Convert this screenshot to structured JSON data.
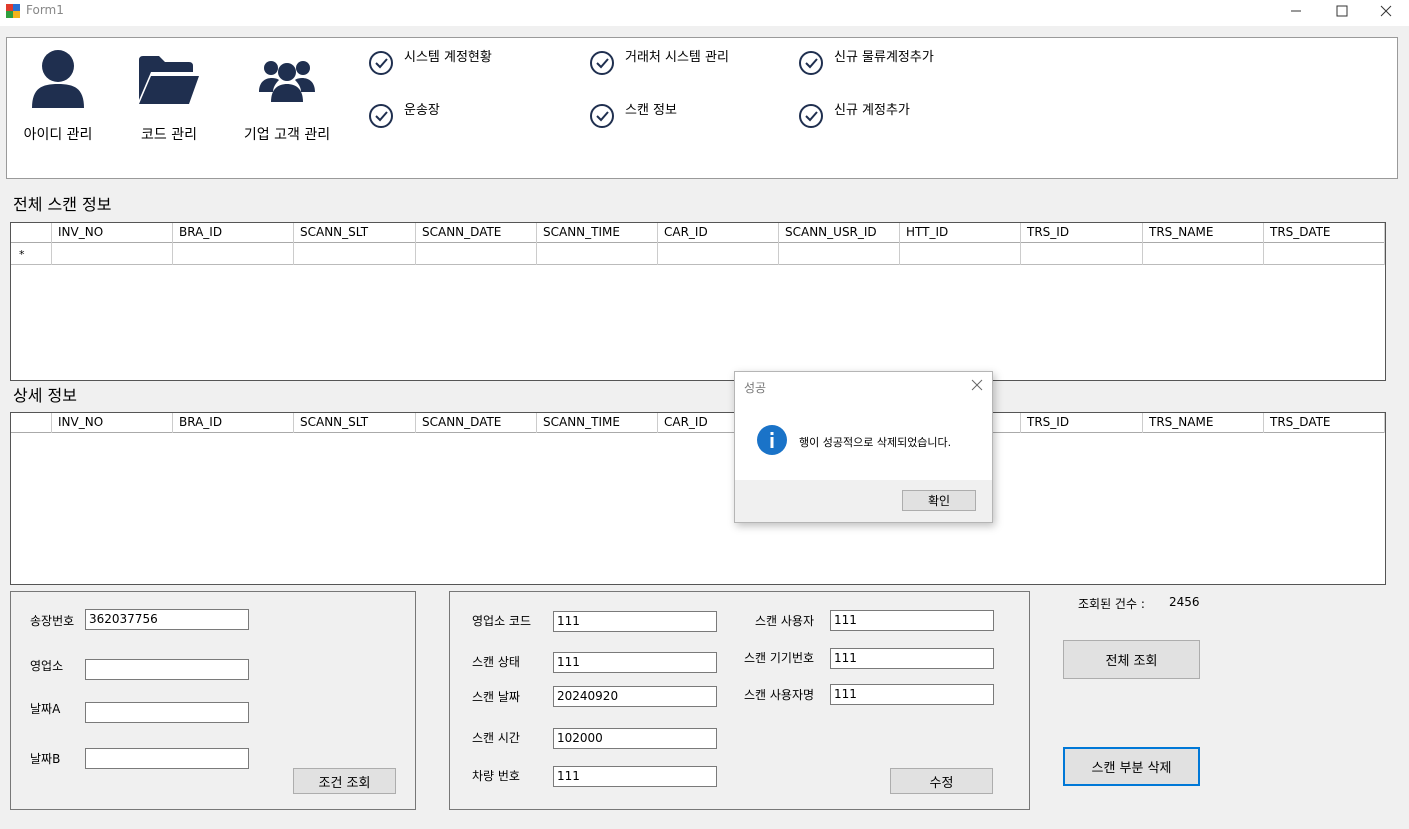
{
  "window": {
    "title": "Form1",
    "minimize_glyph": "—",
    "maximize_glyph": "☐",
    "close_glyph": "✕"
  },
  "menu": {
    "big_items": [
      {
        "label": "아이디 관리",
        "icon": "user-icon"
      },
      {
        "label": "코드 관리",
        "icon": "folder-icon"
      },
      {
        "label": "기업 고객 관리",
        "icon": "users-icon"
      }
    ],
    "check_items": [
      {
        "label": "시스템 계정현황"
      },
      {
        "label": "거래처 시스템 관리"
      },
      {
        "label": "신규 물류계정추가"
      },
      {
        "label": "운송장"
      },
      {
        "label": "스캔 정보"
      },
      {
        "label": "신규 계정추가"
      }
    ]
  },
  "sections": {
    "all_scan": "전체 스캔 정보",
    "detail": "상세 정보"
  },
  "grid": {
    "columns": [
      "INV_NO",
      "BRA_ID",
      "SCANN_SLT",
      "SCANN_DATE",
      "SCANN_TIME",
      "CAR_ID",
      "SCANN_USR_ID",
      "HTT_ID",
      "TRS_ID",
      "TRS_NAME",
      "TRS_DATE"
    ],
    "new_row_marker": "*"
  },
  "search_box": {
    "invoice_label": "송장번호",
    "invoice_value": "362037756",
    "branch_label": "영업소",
    "branch_value": "",
    "date_a_label": "날짜A",
    "date_a_value": "",
    "date_b_label": "날짜B",
    "date_b_value": "",
    "search_button": "조건 조회"
  },
  "edit_box": {
    "branch_code_label": "영업소 코드",
    "branch_code_value": "111",
    "scan_status_label": "스캔 상태",
    "scan_status_value": "111",
    "scan_date_label": "스캔 날짜",
    "scan_date_value": "20240920",
    "scan_time_label": "스캔 시간",
    "scan_time_value": "102000",
    "car_no_label": "차량 번호",
    "car_no_value": "111",
    "scan_user_label": "스캔 사용자",
    "scan_user_value": "111",
    "scan_device_label": "스캔 기기번호",
    "scan_device_value": "111",
    "scan_user_name_label": "스캔 사용자명",
    "scan_user_name_value": "111",
    "update_button": "수정"
  },
  "right_panel": {
    "count_label": "조회된 건수 :",
    "count_value": "2456",
    "all_search_button": "전체 조회",
    "delete_button": "스캔 부분 삭제"
  },
  "dialog": {
    "title": "성공",
    "message": "행이 성공적으로 삭제되었습니다.",
    "ok_button": "확인",
    "icon": "info-icon"
  },
  "colors": {
    "icon_navy": "#1f2f4f",
    "info_blue": "#1a73c8",
    "focus_blue": "#0078d7"
  }
}
